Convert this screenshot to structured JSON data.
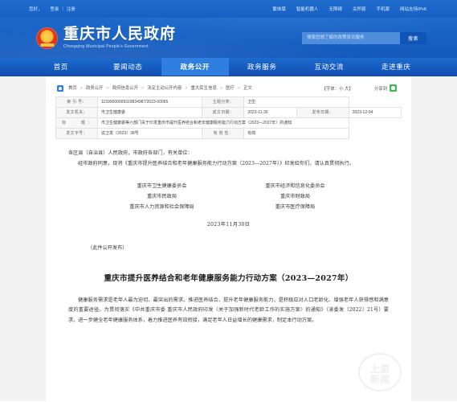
{
  "topbar": {
    "left_items": [
      "您好，",
      "·",
      "登录",
      "|",
      "注册"
    ],
    "right_items": [
      "繁体版",
      "智能机器人",
      "无障碍",
      "关怀版",
      "手机版",
      "网站支持IPv6"
    ]
  },
  "masthead": {
    "title_cn": "重庆市人民政府",
    "title_en": "Chongqing Municipal People's Government",
    "emblem_name": "national-emblem",
    "search_placeholder": "搜索您想了解的政策资讯服务",
    "search_value": "",
    "search_button": "搜索"
  },
  "mainnav": {
    "items": [
      {
        "label": "首页",
        "active": false
      },
      {
        "label": "要闻动态",
        "active": false
      },
      {
        "label": "政务公开",
        "active": true
      },
      {
        "label": "政务服务",
        "active": false
      },
      {
        "label": "互动交流",
        "active": false
      },
      {
        "label": "走进重庆",
        "active": false
      }
    ]
  },
  "breadcrumb": {
    "home_icon": "home-icon",
    "items": [
      "首页",
      "政务公开",
      "政府信息公开",
      "法定主动公开内容",
      "重大民生信息",
      "医疗",
      "正文"
    ],
    "separator": ">"
  },
  "tools": {
    "fontsize_label": "【字体：小 大】",
    "share_label": "分享到",
    "share_icon": "wechat-icon"
  },
  "meta_table": {
    "rows": [
      [
        {
          "label": "索 引 号：",
          "value": "11500000009319834987/2023-00065",
          "span": false
        },
        {
          "label": "主题分类：",
          "value": "卫生"
        }
      ],
      [
        {
          "label": "发文机关：",
          "value": "市卫生健康委"
        },
        {
          "label": "成文日期：",
          "value": "2023-11-30"
        },
        {
          "label": "发布日期：",
          "value": "2023-12-04"
        }
      ],
      [
        {
          "label": "标　　题：",
          "value": "市卫生健康委等六部门关于印发重庆市提升医养结合和老年健康服务能力行动方案（2023—2027年）的通知",
          "span": true
        }
      ],
      [
        {
          "label": "发文字号：",
          "value": "渝卫发〔2023〕38号"
        },
        {
          "label": "有 效 性：",
          "value": "有效"
        }
      ]
    ]
  },
  "document": {
    "salutation": "各区县（自治县）人民政府，市政府各部门，有关单位：",
    "intro": "经市政府同意，现将《重庆市提升医养结合和老年健康服务能力行动方案（2023—2027年）》印发给你们，请认真贯彻执行。",
    "signatures": [
      [
        "重庆市卫生健康委员会",
        "重庆市经济和信息化委员会"
      ],
      [
        "重庆市民政局",
        "重庆市财政局"
      ],
      [
        "重庆市人力资源和社会保障局",
        "重庆市医疗保障局"
      ]
    ],
    "date": "2023年11月30日",
    "notice": "（此件公开发布）",
    "title": "重庆市提升医养结合和老年健康服务能力行动方案（2023—2027年）",
    "body_paragraph": "健康服务需求是老年人最为迫切、最突出的需求。推进医养结合，提升老年健康服务能力，是积极应对人口老龄化、增强老年人获得感和满意度的重要途径。为贯彻落实《中共重庆市委 重庆市人民政府印发〈关于加强新时代老龄工作的实施方案〉的通知》（渝委发〔2022〕21号）要求，进一步健全老年健康服务体系，着力推进医养有效衔接，满足老年人日益增长的健康需求，制定本行动方案。"
  },
  "watermark": {
    "text_top": "上游",
    "text_bottom": "新闻"
  }
}
